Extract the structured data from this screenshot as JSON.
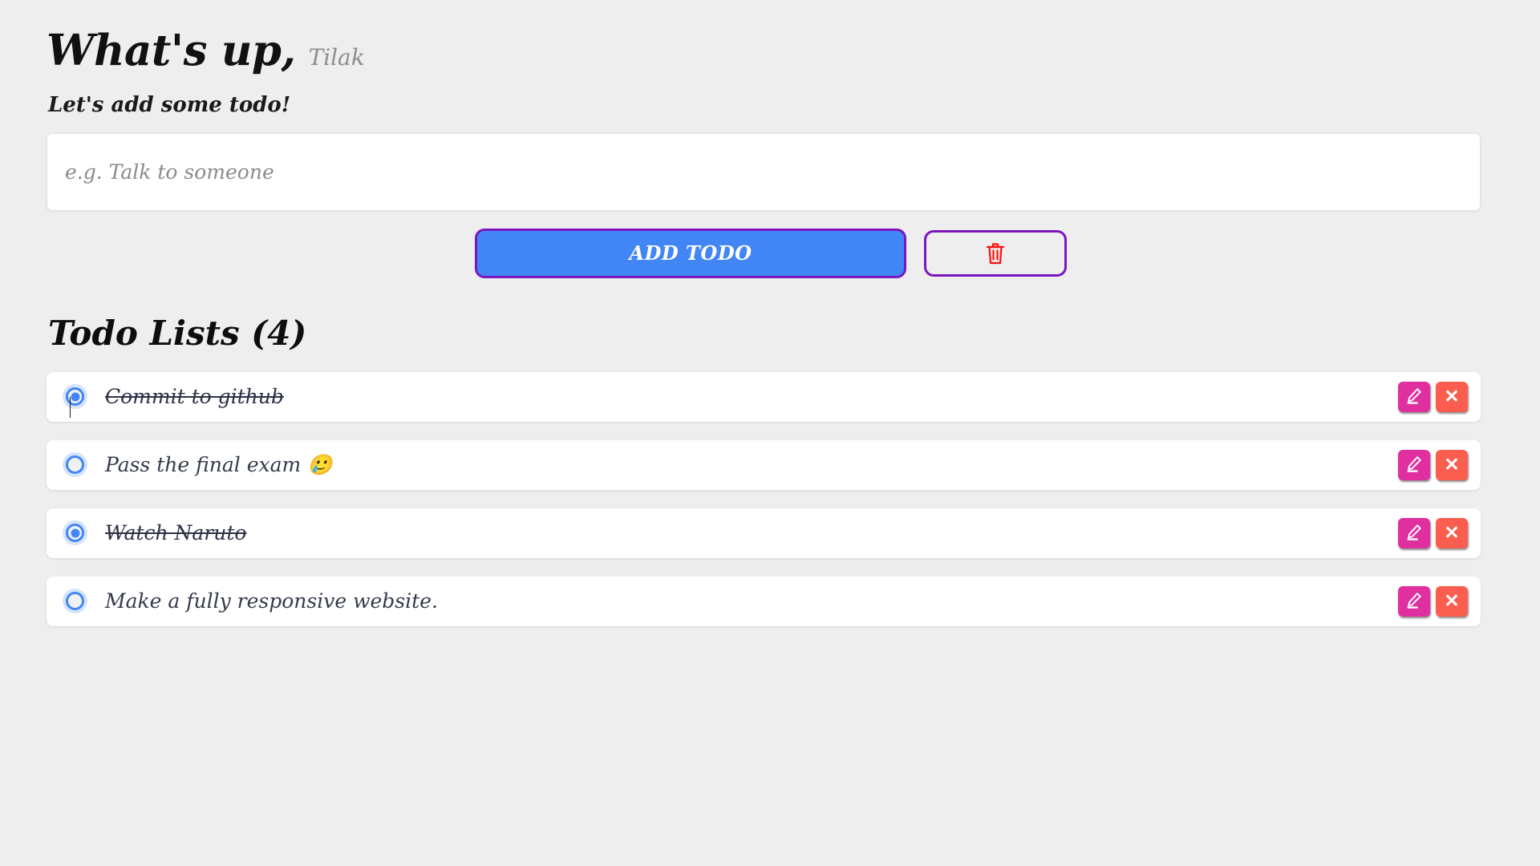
{
  "header": {
    "greeting": "What's up,",
    "user_name": "Tilak",
    "subtitle": "Let's add some todo!"
  },
  "input": {
    "placeholder": "e.g. Talk to someone",
    "value": ""
  },
  "buttons": {
    "add_label": "ADD TODO",
    "clear_icon": "trash-icon"
  },
  "list": {
    "title": "Todo Lists (4)",
    "count": 4,
    "items": [
      {
        "text": "Commit to github",
        "done": true,
        "edit_icon": "pencil-icon",
        "delete_icon": "close-icon"
      },
      {
        "text": "Pass the final exam 🥲",
        "done": false,
        "edit_icon": "pencil-icon",
        "delete_icon": "close-icon"
      },
      {
        "text": "Watch Naruto",
        "done": true,
        "edit_icon": "pencil-icon",
        "delete_icon": "close-icon"
      },
      {
        "text": "Make a fully responsive website.",
        "done": false,
        "edit_icon": "pencil-icon",
        "delete_icon": "close-icon"
      }
    ]
  },
  "icons": {
    "delete_glyph": "✕"
  },
  "colors": {
    "page_background": "#eeeeee",
    "add_button_fill": "#4286f5",
    "button_border": "#7b16bf",
    "trash_red": "#fb0f0f",
    "edit_pink": "#e0309f",
    "delete_red": "#fb5e4f",
    "radio_blue": "#4286f5",
    "name_gray": "#8d8d8d"
  }
}
